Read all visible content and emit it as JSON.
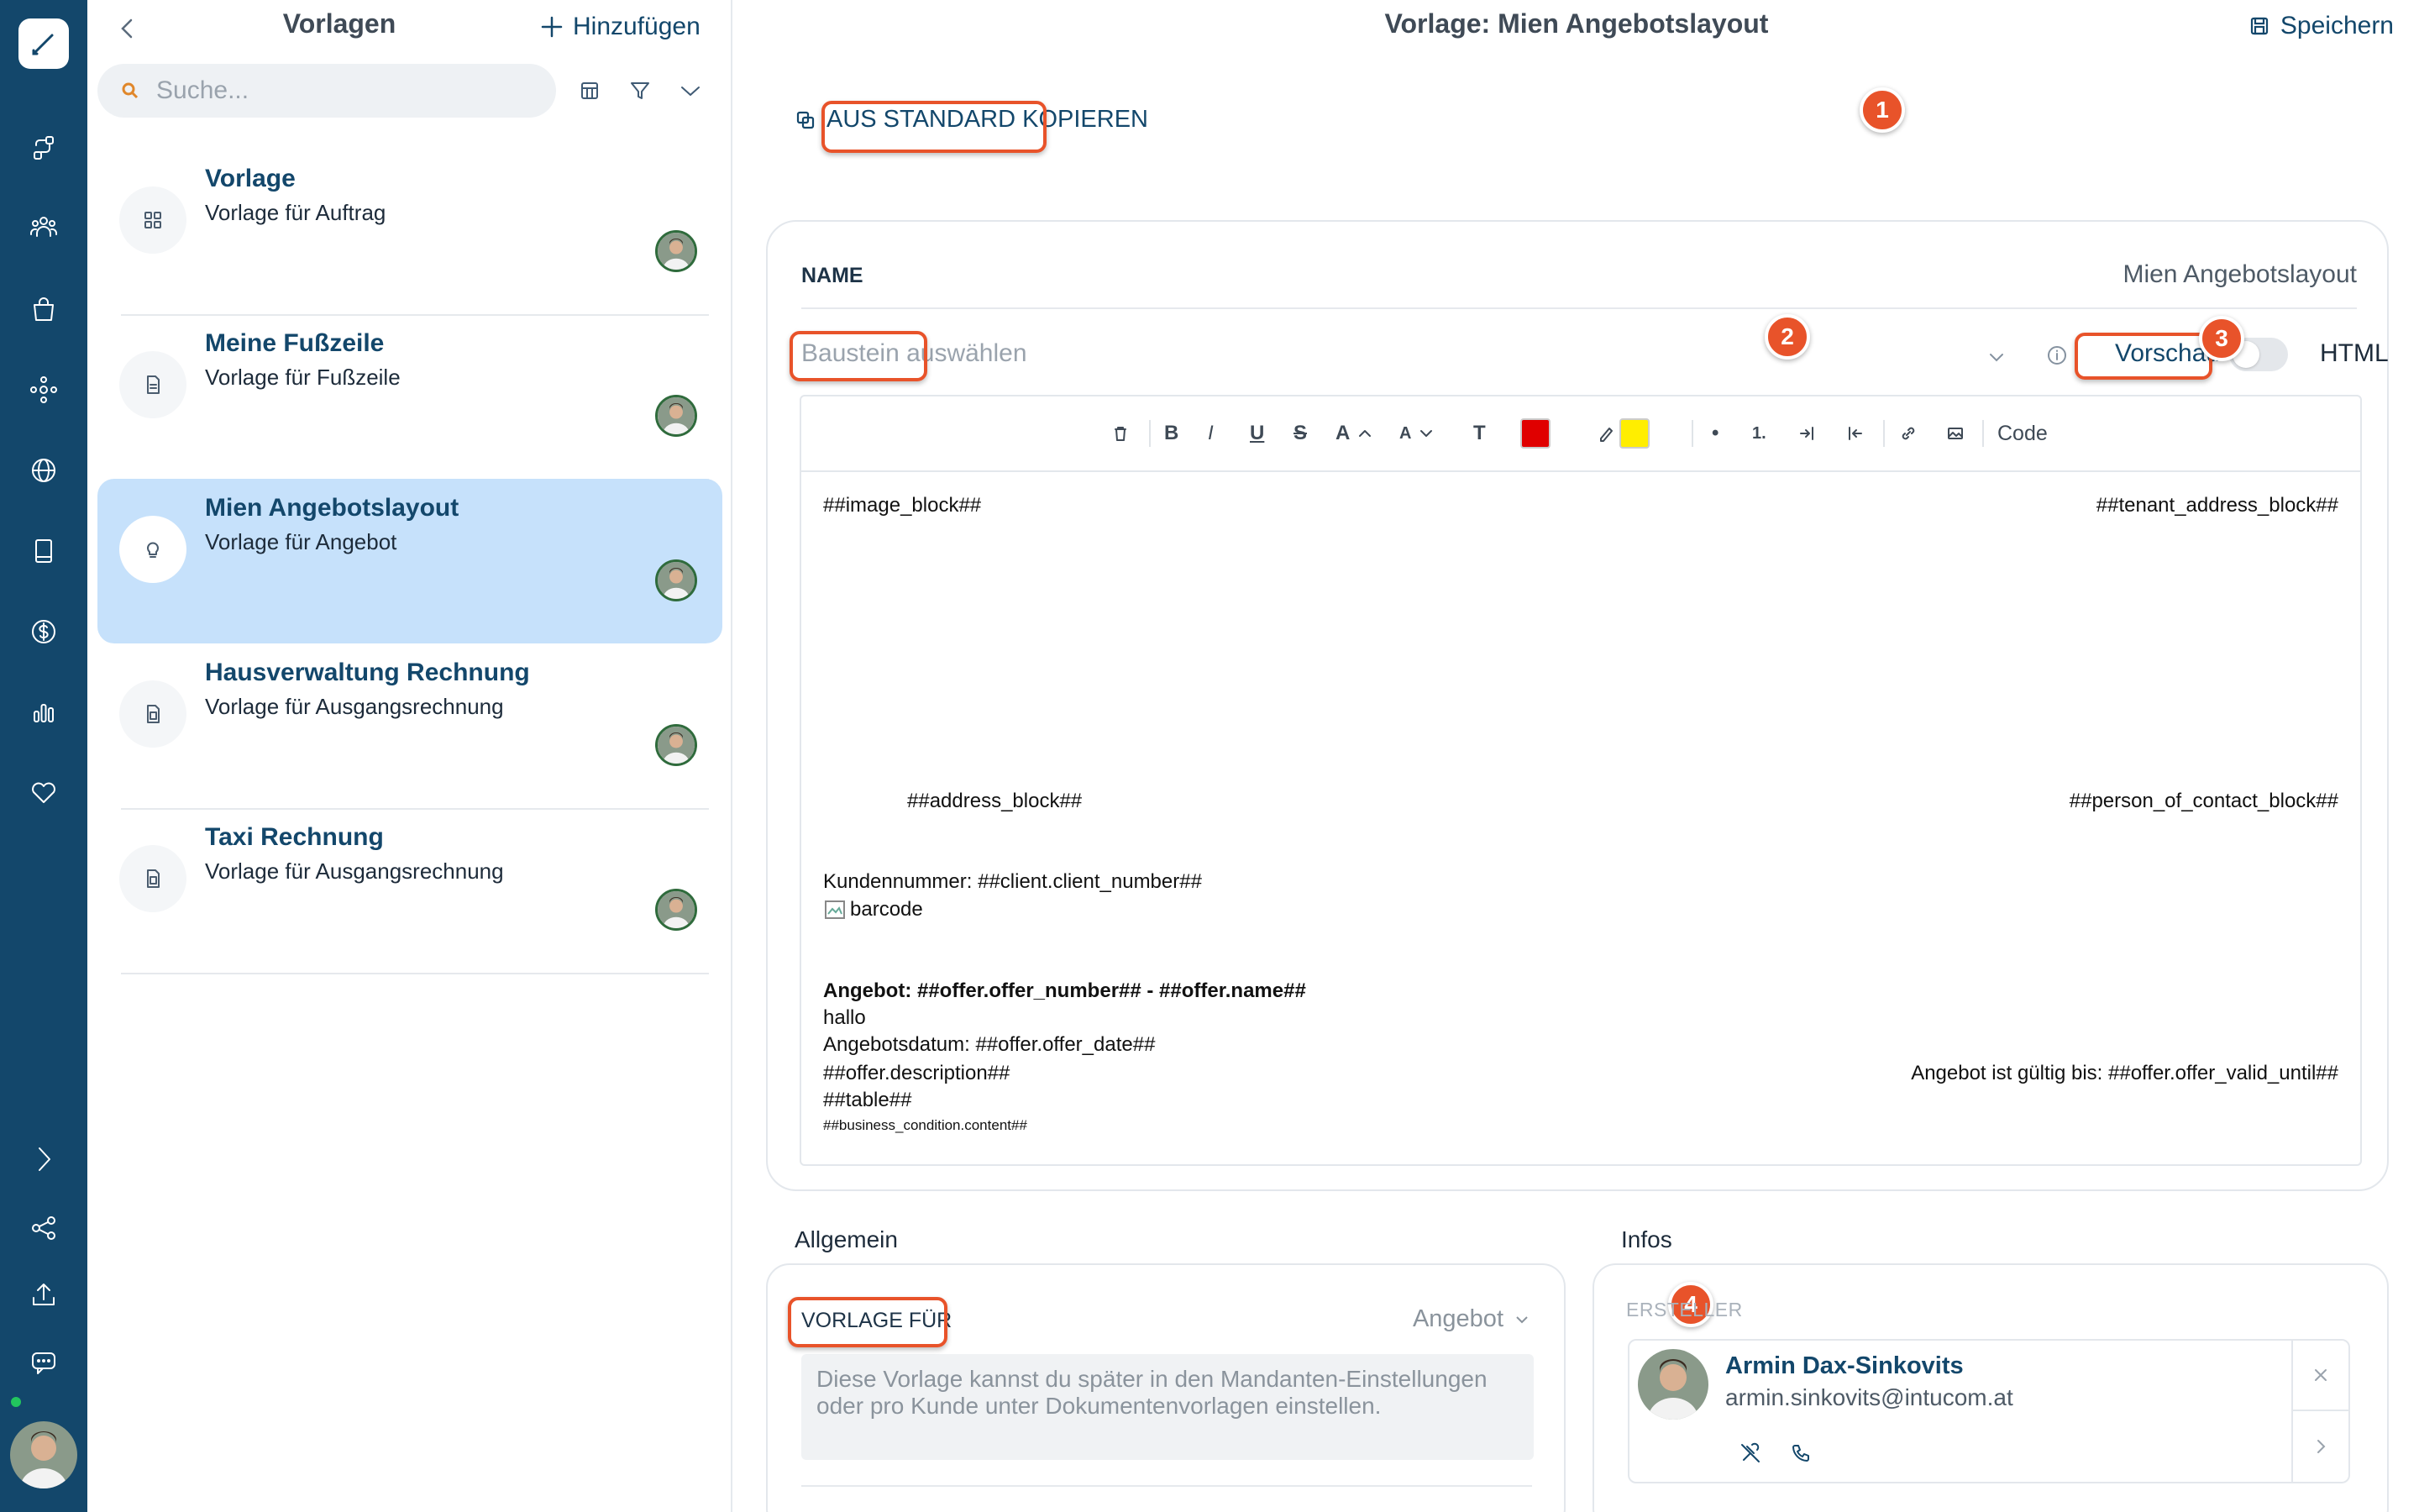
{
  "sidebar_list": {
    "title": "Vorlagen",
    "add_label": "Hinzufügen",
    "search_placeholder": "Suche...",
    "items": [
      {
        "title": "Vorlage",
        "subtitle": "Vorlage für Auftrag",
        "icon": "grid-icon"
      },
      {
        "title": "Meine Fußzeile",
        "subtitle": "Vorlage für Fußzeile",
        "icon": "document-icon"
      },
      {
        "title": "Mien Angebotslayout",
        "subtitle": "Vorlage für Angebot",
        "icon": "lightbulb-icon",
        "selected": true
      },
      {
        "title": "Hausverwaltung Rechnung",
        "subtitle": "Vorlage für Ausgangsrechnung",
        "icon": "invoice-icon"
      },
      {
        "title": "Taxi Rechnung",
        "subtitle": "Vorlage für Ausgangsrechnung",
        "icon": "invoice-icon"
      }
    ]
  },
  "header": {
    "title": "Vorlage: Mien Angebotslayout",
    "save_label": "Speichern"
  },
  "copy_button_label": "AUS STANDARD KOPIEREN",
  "editor_card": {
    "name_label": "NAME",
    "name_value": "Mien Angebotslayout",
    "block_placeholder": "Baustein auswählen",
    "preview_label": "Vorschau",
    "html_label": "HTML",
    "toolbar": {
      "code_label": "Code",
      "text_color": "#e00000",
      "highlight_color": "#ffee00"
    },
    "content": {
      "image_block": "##image_block##",
      "tenant_address_block": "##tenant_address_block##",
      "address_block": "##address_block##",
      "person_of_contact_block": "##person_of_contact_block##",
      "client_number": "Kundennummer: ##client.client_number##",
      "barcode": "barcode",
      "offer_heading": "Angebot: ##offer.offer_number## - ##offer.name##",
      "hallo": "hallo",
      "offer_date": "Angebotsdatum: ##offer.offer_date##",
      "offer_description": "##offer.description##",
      "offer_valid_until": "Angebot ist gültig bis: ##offer.offer_valid_until##",
      "table": "##table##",
      "business_condition": "##business_condition.content##"
    }
  },
  "general": {
    "section_title": "Allgemein",
    "vorlage_fuer_label": "VORLAGE FÜR",
    "vorlage_fuer_value": "Angebot",
    "hint": "Diese Vorlage kannst du später in den Mandanten-Einstellungen oder pro Kunde unter Dokumentenvorlagen einstellen."
  },
  "infos": {
    "section_title": "Infos",
    "creator_label": "ERSTELLER",
    "creator_name": "Armin Dax-Sinkovits",
    "creator_email": "armin.sinkovits@intucom.at"
  },
  "annotations": [
    "1",
    "2",
    "3",
    "4"
  ],
  "colors": {
    "rail": "#13476b",
    "accent": "#13476b",
    "selected_item": "#c6e1fb",
    "annotation": "#e8532a"
  }
}
